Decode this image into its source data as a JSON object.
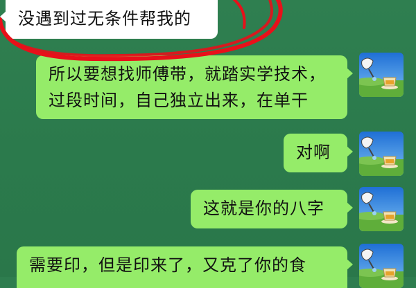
{
  "messages": [
    {
      "id": "m0",
      "side": "in",
      "lines": [
        "没遇到过无条件帮我的"
      ]
    },
    {
      "id": "m1",
      "side": "out",
      "lines": [
        "所以要想找师傅带，就踏实学技术，",
        "过段时间，自己独立出来，在单干"
      ]
    },
    {
      "id": "m2",
      "side": "out",
      "lines": [
        "对啊"
      ]
    },
    {
      "id": "m3",
      "side": "out",
      "lines": [
        "这就是你的八字"
      ]
    },
    {
      "id": "m4",
      "side": "out",
      "lines": [
        "需要印，但是印来了，又克了你的食"
      ]
    }
  ],
  "avatar": {
    "icon": "tea-cup-landscape-icon"
  },
  "colors": {
    "chat_background": "#2e7d4f",
    "incoming_bubble": "#ffffff",
    "outgoing_bubble": "#95ec69",
    "annotation": "#e8101a"
  }
}
